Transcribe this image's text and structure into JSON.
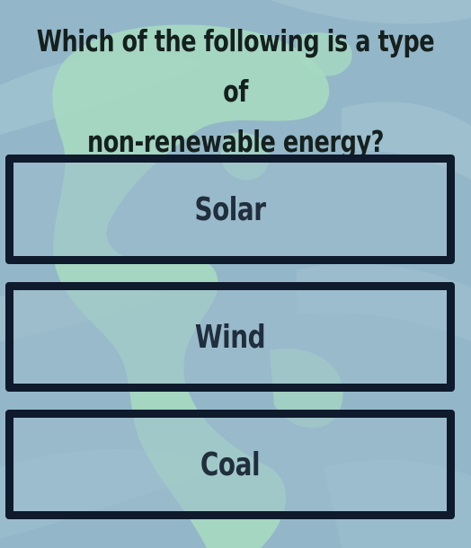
{
  "question": {
    "line1": "Which of the following is a type of",
    "line2": "non-renewable energy?"
  },
  "options": [
    {
      "label": "Solar"
    },
    {
      "label": "Wind"
    },
    {
      "label": "Coal"
    }
  ],
  "colors": {
    "background": "#8fb3c4",
    "land": "#a6d9c1",
    "border": "#0f1a2c",
    "text": "#15201e"
  }
}
